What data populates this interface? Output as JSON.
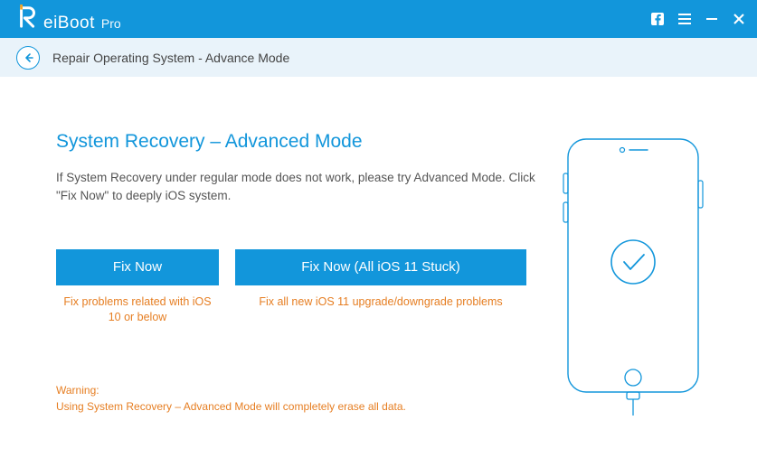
{
  "titlebar": {
    "app_name": "eiBoot",
    "app_suffix": "Pro"
  },
  "breadcrumb": {
    "text": "Repair Operating System - Advance Mode"
  },
  "main": {
    "heading": "System Recovery – Advanced Mode",
    "description": "If System Recovery under regular mode does not work, please try Advanced Mode. Click \"Fix Now\" to deeply iOS system.",
    "button1_label": "Fix Now",
    "button2_label": "Fix Now (All iOS 11 Stuck)",
    "caption1": "Fix problems related with iOS 10 or below",
    "caption2": "Fix all new iOS 11 upgrade/downgrade problems",
    "warning_label": "Warning:",
    "warning_text": "Using System Recovery – Advanced Mode will completely erase all data."
  }
}
